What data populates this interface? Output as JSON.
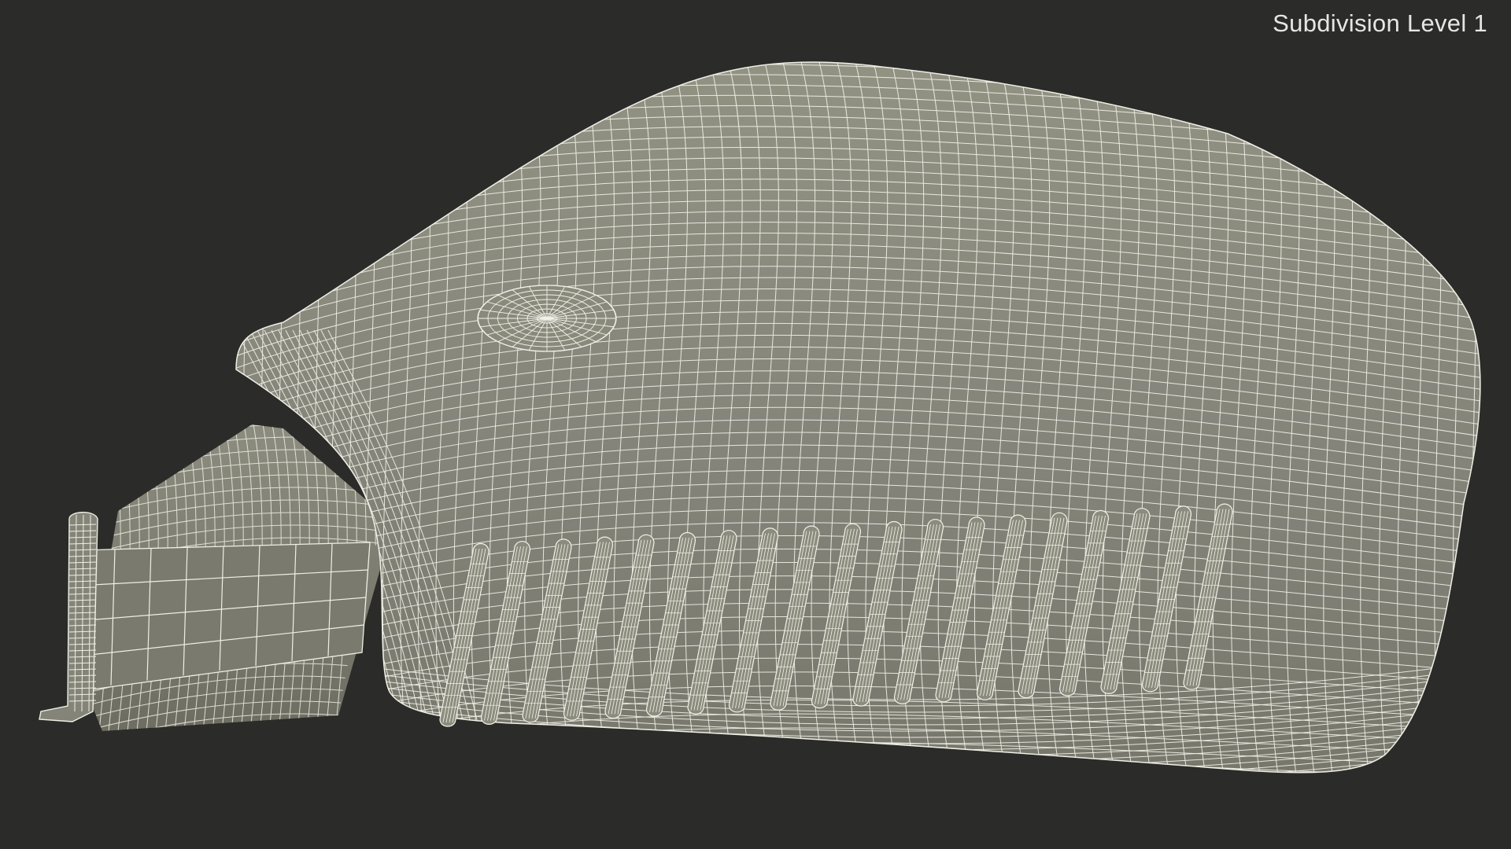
{
  "viewport": {
    "overlay_label": "Subdivision Level 1",
    "object": "side-mirror-wireframe",
    "colors": {
      "background": "#2b2b29",
      "surface": "#8a8a7a",
      "surface_shadow": "#6f6f62",
      "wire": "#f2f2ea",
      "label": "#e6e6e2"
    }
  }
}
